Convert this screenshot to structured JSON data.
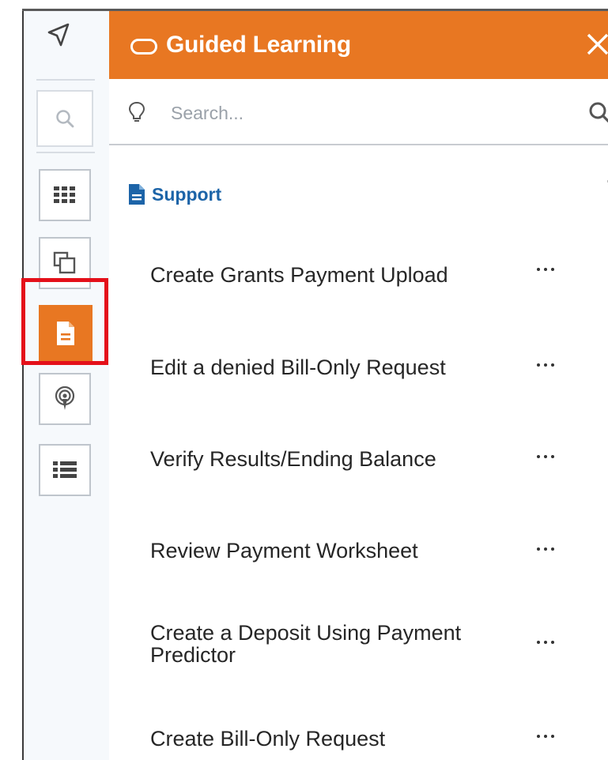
{
  "rail": {
    "items": [
      {
        "icon": "send-arrow-icon"
      },
      {
        "icon": "search-icon"
      },
      {
        "icon": "grid-apps-icon"
      },
      {
        "icon": "copy-pages-icon"
      },
      {
        "icon": "document-icon",
        "active": true
      },
      {
        "icon": "broadcast-icon"
      },
      {
        "icon": "list-icon"
      }
    ]
  },
  "header": {
    "title": "Guided Learning",
    "close_icon": "close-icon",
    "background": "#e87722"
  },
  "search": {
    "placeholder": "Search...",
    "value": ""
  },
  "section": {
    "title": "Support",
    "color": "#1c64a8"
  },
  "items": [
    {
      "label": "Create Grants Payment Upload"
    },
    {
      "label": "Edit a denied Bill-Only Request"
    },
    {
      "label": "Verify Results/Ending Balance"
    },
    {
      "label": "Review Payment Worksheet"
    },
    {
      "label": "Create a Deposit Using Payment Predictor"
    },
    {
      "label": "Create Bill-Only Request"
    }
  ]
}
